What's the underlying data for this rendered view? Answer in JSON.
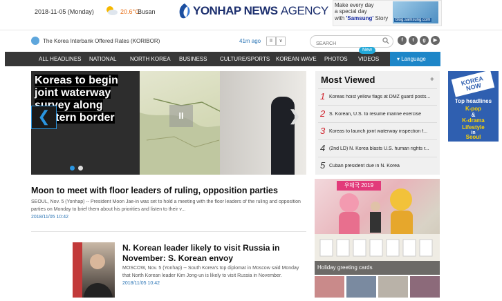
{
  "header": {
    "date": "2018-11-05 (Monday)",
    "temperature": "20.6°C",
    "city": "Busan",
    "logo_main": "YONHAP NEWS",
    "logo_agency": "AGENCY",
    "ad": {
      "line1": "Make every day",
      "line2": "a special day",
      "line3_prefix": "with ",
      "line3_brand": "'Samsung'",
      "line3_suffix": " Story",
      "url": "blog.samsung.com"
    }
  },
  "ticker": {
    "text": "The Korea Interbank Offered Rates (KORIBOR)",
    "time_ago": "41m ago",
    "pause_label": "II",
    "down_label": "∨"
  },
  "search": {
    "placeholder": "SEARCH"
  },
  "social": [
    "f",
    "t",
    "g",
    "▶"
  ],
  "nav": {
    "items": [
      "ALL HEADLINES",
      "NATIONAL",
      "NORTH KOREA",
      "BUSINESS",
      "CULTURE/SPORTS",
      "KOREAN WAVE",
      "PHOTOS",
      "VIDEOS"
    ],
    "new_badge": "New",
    "language": "Language"
  },
  "slider": {
    "title": "Koreas to begin joint waterway survey along western border",
    "prev": "❮",
    "next": "❯",
    "pause": "II"
  },
  "main_story": {
    "headline": "Moon to meet with floor leaders of ruling, opposition parties",
    "body": "SEOUL, Nov. 5 (Yonhap) -- President Moon Jae-in was set to hold a meeting with the floor leaders of the ruling and opposition parties on Monday to brief them about his priorities and listen to their v...",
    "date": "2018/11/05 10:42"
  },
  "story2": {
    "headline": "N. Korean leader likely to visit Russia in November: S. Korean envoy",
    "body": "MOSCOW, Nov. 5 (Yonhap) -- South Korea's top diplomat in Moscow said Monday that North Korean leader Kim Jong-un is likely to visit Russia in November.",
    "date": "2018/11/05 10:42"
  },
  "most_viewed": {
    "title": "Most Viewed",
    "plus": "+",
    "items": [
      {
        "num": "1",
        "text": "Koreas hoist yellow flags at DMZ guard posts..."
      },
      {
        "num": "2",
        "text": "S. Korean, U.S. to resume marine exercise"
      },
      {
        "num": "3",
        "text": "Koreas to launch joint waterway inspection f..."
      },
      {
        "num": "4",
        "text": "(2nd LD) N. Korea blasts U.S. human rights r..."
      },
      {
        "num": "5",
        "text": "Cuban president due in N. Korea"
      }
    ]
  },
  "photo": {
    "banner": "우체국 2019",
    "caption": "Holiday greeting cards"
  },
  "right_ad": {
    "logo": "KOREA NOW",
    "line1": "Top headlines",
    "line2": "K-pop",
    "line3": "&",
    "line4": "K-drama",
    "line5": "Lifestyle",
    "line6": "in",
    "line7": "Seoul"
  },
  "colors": {
    "nav_bg": "#373737",
    "accent_blue": "#1d86c8",
    "rank_red": "#d0202a",
    "rank_dark": "#333333",
    "link_blue": "#2a74b5"
  }
}
